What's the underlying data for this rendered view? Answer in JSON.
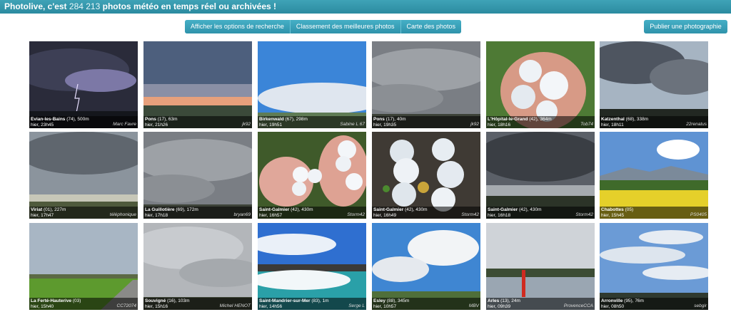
{
  "header": {
    "title_start": "Photolive, c'est ",
    "count": "284 213",
    "title_end": " photos météo en temps réel ou archivées !"
  },
  "toolbar": {
    "search_options": "Afficher les options de recherche",
    "best_photos": "Classement des meilleures photos",
    "map": "Carte des photos",
    "publish": "Publier une photographie"
  },
  "photos": [
    {
      "place": "Évian-les-Bains",
      "meta": " (74), 500m",
      "when": "hier, 23h45",
      "author": "Marc Favre",
      "scene": "lightning"
    },
    {
      "place": "Pons",
      "meta": " (17), 63m",
      "when": "hier, 21h26",
      "author": "jk92",
      "scene": "sunset"
    },
    {
      "place": "Birkenwald",
      "meta": " (67), 298m",
      "when": "hier, 19h51",
      "author": "Sabine L 67",
      "scene": "bluesky"
    },
    {
      "place": "Pons",
      "meta": " (17), 40m",
      "when": "hier, 19h35",
      "author": "jk92",
      "scene": "grey"
    },
    {
      "place": "L'Hôpital-le-Grand",
      "meta": " (42), 364m",
      "when": "hier, 18h16",
      "author": "Tob74",
      "scene": "hailhand"
    },
    {
      "place": "Katzenthal",
      "meta": " (68), 338m",
      "when": "hier, 18h11",
      "author": "22renatus",
      "scene": "darkclouds"
    },
    {
      "place": "Viriat",
      "meta": " (01), 227m",
      "when": "hier, 17h47",
      "author": "téléphonique",
      "scene": "stormfield"
    },
    {
      "place": "La Guillotière",
      "meta": " (69), 172m",
      "when": "hier, 17h18",
      "author": "bryan69",
      "scene": "grey"
    },
    {
      "place": "Saint-Galmier",
      "meta": " (42), 430m",
      "when": "hier, 16h57",
      "author": "Storm42",
      "scene": "hailhands"
    },
    {
      "place": "Saint-Galmier",
      "meta": " (42), 430m",
      "when": "hier, 16h49",
      "author": "Storm42",
      "scene": "hailground"
    },
    {
      "place": "Saint-Galmier",
      "meta": " (42), 430m",
      "when": "hier, 16h18",
      "author": "Storm42",
      "scene": "shelf"
    },
    {
      "place": "Chabottes",
      "meta": " (05)",
      "when": "hier, 15h45",
      "author": "PS0405",
      "scene": "mountain"
    },
    {
      "place": "La Ferté-Hauterive",
      "meta": " (03)",
      "when": "hier, 15h40",
      "author": "CC72074",
      "scene": "road"
    },
    {
      "place": "Souvigné",
      "meta": " (16), 103m",
      "when": "hier, 15h16",
      "author": "Michel HENOT",
      "scene": "overcast"
    },
    {
      "place": "Saint-Mandrier-sur-Mer",
      "meta": " (83), 1m",
      "when": "hier, 14h56",
      "author": "Serge L",
      "scene": "sea"
    },
    {
      "place": "Esley",
      "meta": " (88), 345m",
      "when": "hier, 10h57",
      "author": "MBV",
      "scene": "cumulus"
    },
    {
      "place": "Arles",
      "meta": " (13), 24m",
      "when": "hier, 09h39",
      "author": "ProvenceCCA",
      "scene": "river"
    },
    {
      "place": "Arronville",
      "meta": " (95), 76m",
      "when": "hier, 08h50",
      "author": "sebgir",
      "scene": "altocumulus"
    }
  ]
}
